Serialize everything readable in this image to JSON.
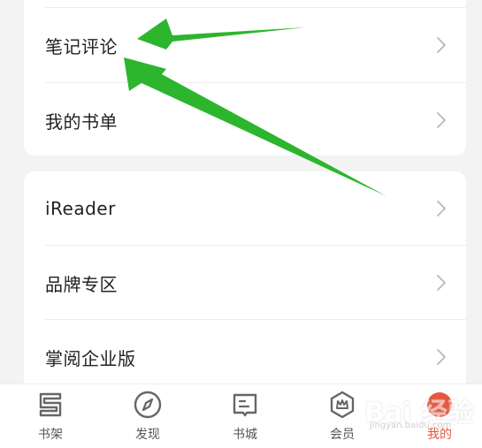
{
  "menu_group_1": [
    {
      "label": "笔记评论"
    },
    {
      "label": "我的书单"
    }
  ],
  "menu_group_2": [
    {
      "label": "iReader"
    },
    {
      "label": "品牌专区"
    },
    {
      "label": "掌阅企业版"
    }
  ],
  "tabbar": {
    "items": [
      {
        "label": "书架",
        "icon": "bookshelf-icon"
      },
      {
        "label": "发现",
        "icon": "compass-icon"
      },
      {
        "label": "书城",
        "icon": "book-store-icon"
      },
      {
        "label": "会员",
        "icon": "crown-badge-icon"
      },
      {
        "label": "我的",
        "icon": "profile-icon"
      }
    ],
    "active_index": 4
  },
  "colors": {
    "accent": "#e8563f",
    "annotation_arrow": "#2db52d"
  },
  "watermark": {
    "text": "Bai 经验",
    "url": "jingyan.baidu.com"
  }
}
